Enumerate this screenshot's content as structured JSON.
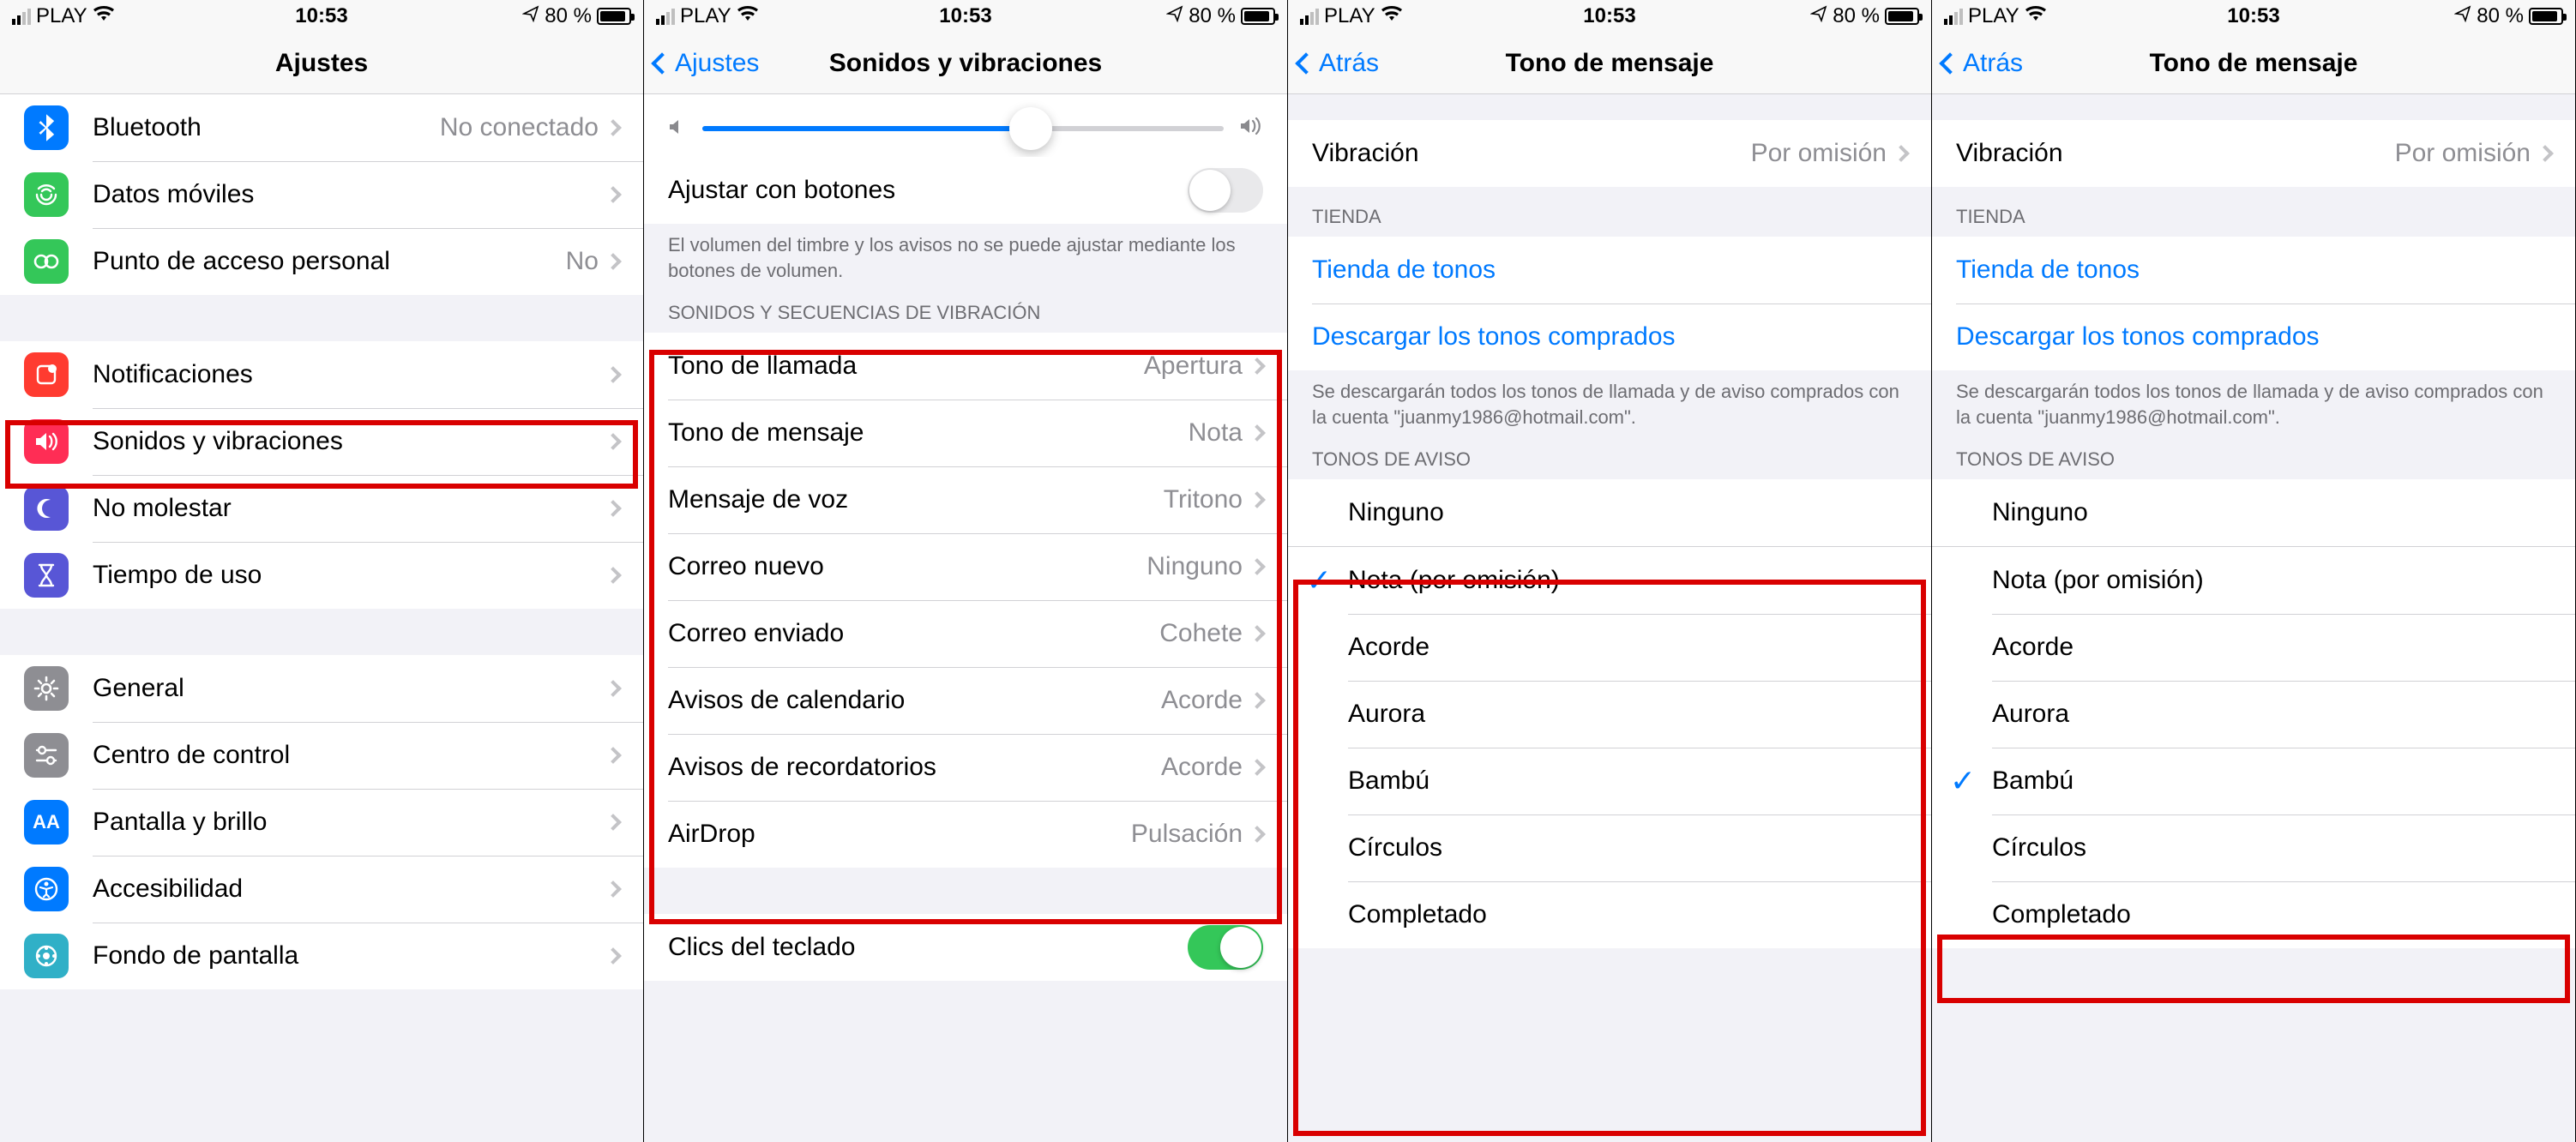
{
  "status": {
    "carrier": "PLAY",
    "time": "10:53",
    "battery_pct": "80 %"
  },
  "screen1": {
    "title": "Ajustes",
    "rows": {
      "bluetooth": {
        "label": "Bluetooth",
        "value": "No conectado"
      },
      "cellular": {
        "label": "Datos móviles"
      },
      "hotspot": {
        "label": "Punto de acceso personal",
        "value": "No"
      },
      "notifications": {
        "label": "Notificaciones"
      },
      "sounds": {
        "label": "Sonidos y vibraciones"
      },
      "dnd": {
        "label": "No molestar"
      },
      "screentime": {
        "label": "Tiempo de uso"
      },
      "general": {
        "label": "General"
      },
      "cc": {
        "label": "Centro de control"
      },
      "display": {
        "label": "Pantalla y brillo"
      },
      "access": {
        "label": "Accesibilidad"
      },
      "wallpaper": {
        "label": "Fondo de pantalla"
      }
    }
  },
  "screen2": {
    "back": "Ajustes",
    "title": "Sonidos y vibraciones",
    "adjust_buttons": "Ajustar con botones",
    "adjust_footer": "El volumen del timbre y los avisos no se puede ajustar mediante los botones de volumen.",
    "sounds_header": "SONIDOS Y SECUENCIAS DE VIBRACIÓN",
    "rows": {
      "ringtone": {
        "label": "Tono de llamada",
        "value": "Apertura"
      },
      "texttone": {
        "label": "Tono de mensaje",
        "value": "Nota"
      },
      "voicemail": {
        "label": "Mensaje de voz",
        "value": "Tritono"
      },
      "newmail": {
        "label": "Correo nuevo",
        "value": "Ninguno"
      },
      "sentmail": {
        "label": "Correo enviado",
        "value": "Cohete"
      },
      "calendar": {
        "label": "Avisos de calendario",
        "value": "Acorde"
      },
      "reminders": {
        "label": "Avisos de recordatorios",
        "value": "Acorde"
      },
      "airdrop": {
        "label": "AirDrop",
        "value": "Pulsación"
      }
    },
    "keyboard": "Clics del teclado"
  },
  "tone": {
    "back": "Atrás",
    "title": "Tono de mensaje",
    "vibration": {
      "label": "Vibración",
      "value": "Por omisión"
    },
    "store_header": "TIENDA",
    "store_rows": {
      "store": "Tienda de tonos",
      "download": "Descargar los tonos comprados"
    },
    "store_footer": "Se descargarán todos los tonos de llamada y de aviso comprados con la cuenta \"juanmy1986@hotmail.com\".",
    "alert_header": "TONOS DE AVISO",
    "tones": {
      "none": "Ninguno",
      "nota": "Nota (por omisión)",
      "acorde": "Acorde",
      "aurora": "Aurora",
      "bambu": "Bambú",
      "circulos": "Círculos",
      "completado": "Completado"
    }
  }
}
